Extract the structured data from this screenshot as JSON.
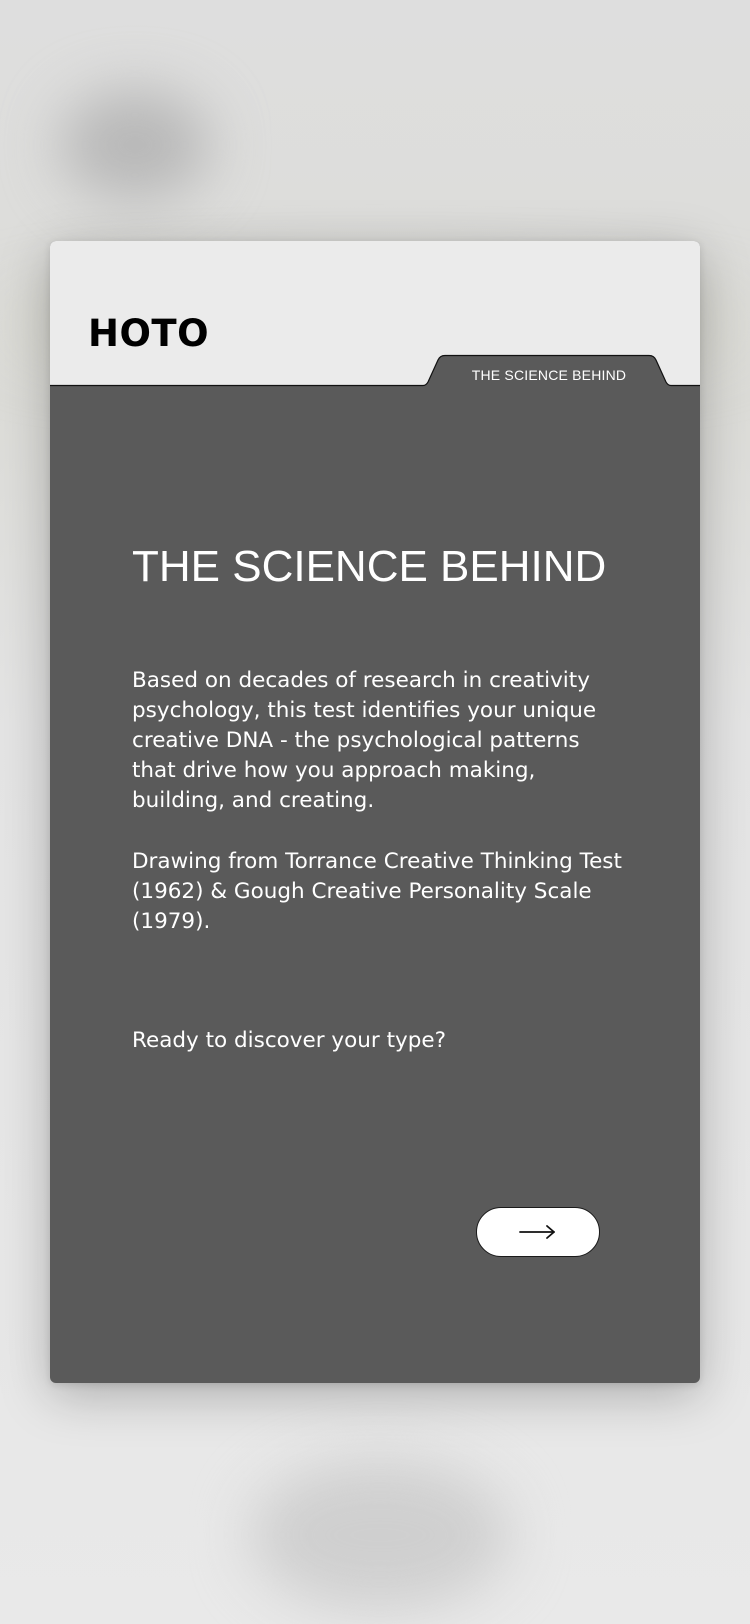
{
  "brand": {
    "logo_text": "HOTO"
  },
  "tab": {
    "label": "THE SCIENCE BEHIND"
  },
  "main": {
    "title": "THE SCIENCE BEHIND",
    "paragraph_1": "Based on decades of research in creativity psychology, this test identifies your unique creative DNA - the psychological patterns that drive how you approach making, building, and creating.",
    "paragraph_2": "Drawing from Torrance Creative Thinking Test (1962) & Gough Creative Personality Scale (1979).",
    "prompt": "Ready to discover your type?"
  },
  "actions": {
    "next_icon": "arrow-right-icon"
  },
  "colors": {
    "page_background": "#e6e6e6",
    "card_header": "#ebebeb",
    "card_body": "#5a5a5a",
    "text_light": "#ffffff",
    "logo": "#000000",
    "button_background": "#ffffff"
  }
}
